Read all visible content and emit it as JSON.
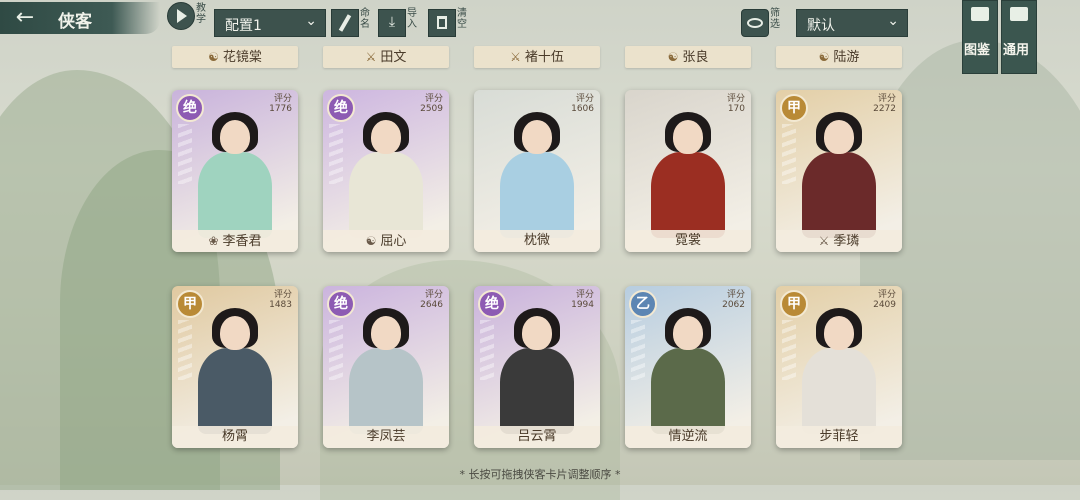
{
  "header": {
    "title": "侠客",
    "teach_label": "教学",
    "config_selected": "配置1",
    "rename_label": "命名",
    "import_label": "导入",
    "clear_label": "清空",
    "filter_label": "筛选",
    "sort_selected": "默认",
    "side_buttons": [
      "图鉴",
      "通用"
    ]
  },
  "top_row_names": [
    {
      "name": "花镜棠",
      "icon": "yin-yang-icon"
    },
    {
      "name": "田文",
      "icon": "sword-icon"
    },
    {
      "name": "褚十伍",
      "icon": "sword-icon"
    },
    {
      "name": "张良",
      "icon": "yin-yang-icon"
    },
    {
      "name": "陆游",
      "icon": "yin-yang-icon"
    }
  ],
  "cards": [
    {
      "name": "李香君",
      "rank": "绝",
      "score_label": "评分",
      "score": "1776",
      "icon": "lotus-icon",
      "theme": "#c9b3dc",
      "rank_color": "#8d5bb3",
      "robe": "#9fd3bf"
    },
    {
      "name": "屈心",
      "rank": "绝",
      "score_label": "评分",
      "score": "2509",
      "icon": "yin-yang-icon",
      "theme": "#cdb6e0",
      "rank_color": "#8d5bb3",
      "robe": "#e8e6d6"
    },
    {
      "name": "枕微",
      "rank": "",
      "score_label": "评分",
      "score": "1606",
      "icon": "",
      "theme": "#d8dcd6",
      "rank_color": "",
      "robe": "#a9cfe2"
    },
    {
      "name": "霓裳",
      "rank": "",
      "score_label": "评分",
      "score": "170",
      "icon": "",
      "theme": "#d9d5cc",
      "rank_color": "",
      "robe": "#9b2e22"
    },
    {
      "name": "季璘",
      "rank": "甲",
      "score_label": "评分",
      "score": "2272",
      "icon": "sword-icon",
      "theme": "#e3cfa7",
      "rank_color": "#b98a36",
      "robe": "#6b2a2a"
    },
    {
      "name": "杨霄",
      "rank": "甲",
      "score_label": "评分",
      "score": "1483",
      "icon": "",
      "theme": "#e0c9a0",
      "rank_color": "#b98a36",
      "robe": "#4a5a66"
    },
    {
      "name": "李凤芸",
      "rank": "绝",
      "score_label": "评分",
      "score": "2646",
      "icon": "",
      "theme": "#cbb4de",
      "rank_color": "#8d5bb3",
      "robe": "#b6c4c8"
    },
    {
      "name": "吕云霄",
      "rank": "绝",
      "score_label": "评分",
      "score": "1994",
      "icon": "",
      "theme": "#c9b2dc",
      "rank_color": "#8d5bb3",
      "robe": "#3a3a3a"
    },
    {
      "name": "情逆流",
      "rank": "乙",
      "score_label": "评分",
      "score": "2062",
      "icon": "",
      "theme": "#b7cde0",
      "rank_color": "#5d86b3",
      "robe": "#5b6a4a"
    },
    {
      "name": "步菲轻",
      "rank": "甲",
      "score_label": "评分",
      "score": "2409",
      "icon": "",
      "theme": "#e3cfa7",
      "rank_color": "#b98a36",
      "robe": "#e4e0d8"
    }
  ],
  "footer_hint": "* 长按可拖拽侠客卡片调整顺序 *"
}
